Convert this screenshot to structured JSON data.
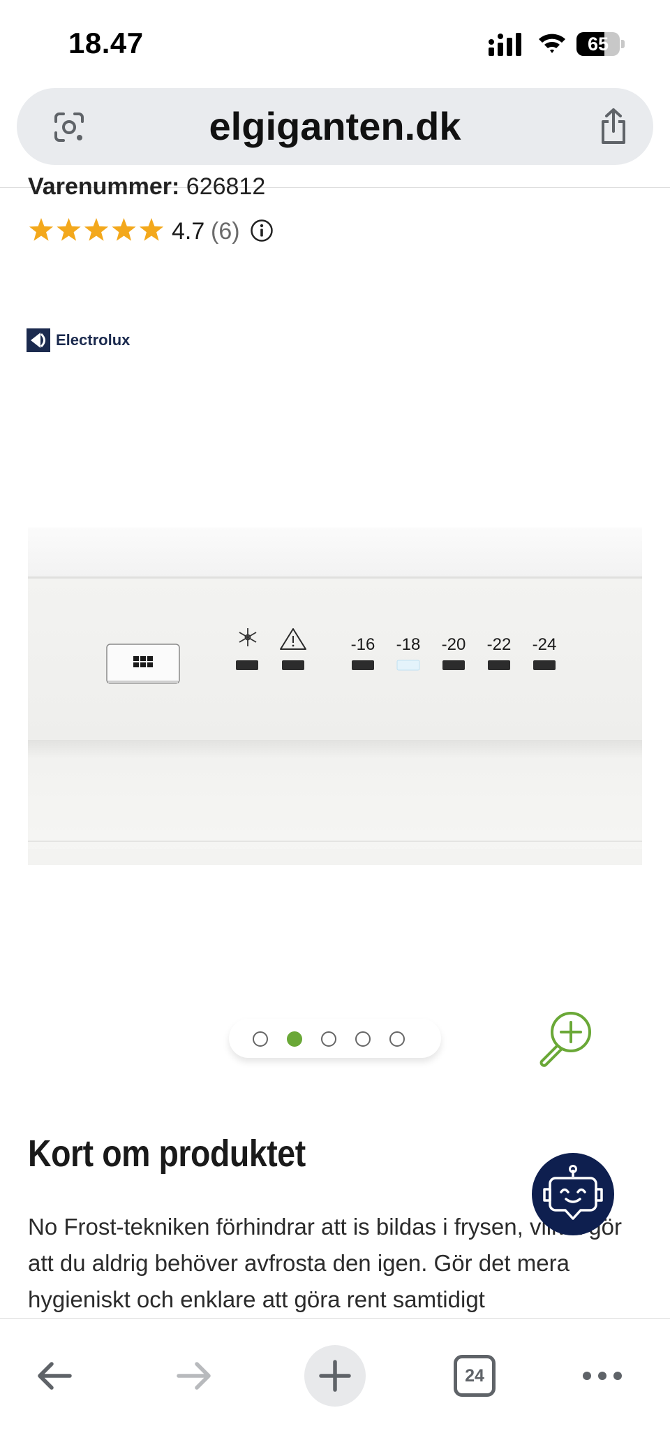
{
  "status_bar": {
    "time": "18.47",
    "battery_level": "65",
    "battery_fraction": 0.65,
    "icons": [
      "cellular-signal-icon",
      "wifi-icon",
      "battery-icon"
    ]
  },
  "browser": {
    "url": "elgiganten.dk",
    "icons": [
      "lens-icon",
      "share-icon"
    ]
  },
  "product": {
    "sku_label": "Varenummer:",
    "sku_value": "626812",
    "rating_value": "4.7",
    "rating_count": "(6)",
    "star_count": 5,
    "star_color": "#f3a81c",
    "brand": "Electrolux"
  },
  "control_panel": {
    "temperatures": [
      "-16",
      "-18",
      "-20",
      "-22",
      "-24"
    ],
    "selected_temperature": "-18",
    "icons": [
      "fast-freeze-icon",
      "warning-icon",
      "menu-grid-icon"
    ]
  },
  "carousel": {
    "total": 5,
    "active_index": 1,
    "active_color": "#6aa837"
  },
  "description": {
    "title": "Kort om produktet",
    "text": "No Frost-tekniken förhindrar att is bildas i frysen, vilket gör att du aldrig behöver avfrosta den igen. Gör det mera hygieniskt och enklare att göra rent samtidigt"
  },
  "chat": {
    "icon": "chat-bot-icon",
    "color": "#0e1f4f"
  },
  "toolbar": {
    "tab_count": "24",
    "icons": [
      "back-arrow-icon",
      "forward-arrow-icon",
      "new-tab-plus-icon",
      "tabs-icon",
      "more-icon"
    ]
  }
}
